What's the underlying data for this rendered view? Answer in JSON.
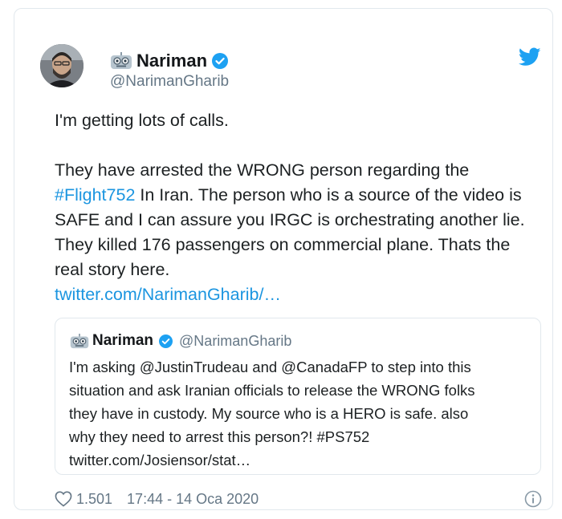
{
  "tweet": {
    "author_name": "Nariman",
    "author_handle": "@NarimanGharib",
    "line1": "I'm getting lots of calls.",
    "para2_a": "They have arrested the WRONG person regarding the",
    "hashtag": "#Flight752",
    "para2_b": " In Iran. The person who is a source of the video is SAFE and I can assure you IRGC is orchestrating another lie. They killed 176 passengers on commercial plane. Thats the real story here.",
    "link": "twitter.com/NarimanGharib/…",
    "likes": "1.501",
    "timestamp": "17:44 - 14 Oca 2020"
  },
  "quoted": {
    "author_name": "Nariman",
    "author_handle": "@NarimanGharib",
    "line1": "I'm asking  @JustinTrudeau   and @CanadaFP  to step into this",
    "line2": "situation and ask Iranian officials to release the WRONG folks",
    "line3": "they have in custody. My source who is a HERO is safe. also",
    "line4": "why they need to arrest this person?! #PS752",
    "line5": "twitter.com/Josiensor/stat…"
  },
  "colors": {
    "link": "#1b95e0",
    "verified": "#1da1f2",
    "muted": "#657786"
  }
}
